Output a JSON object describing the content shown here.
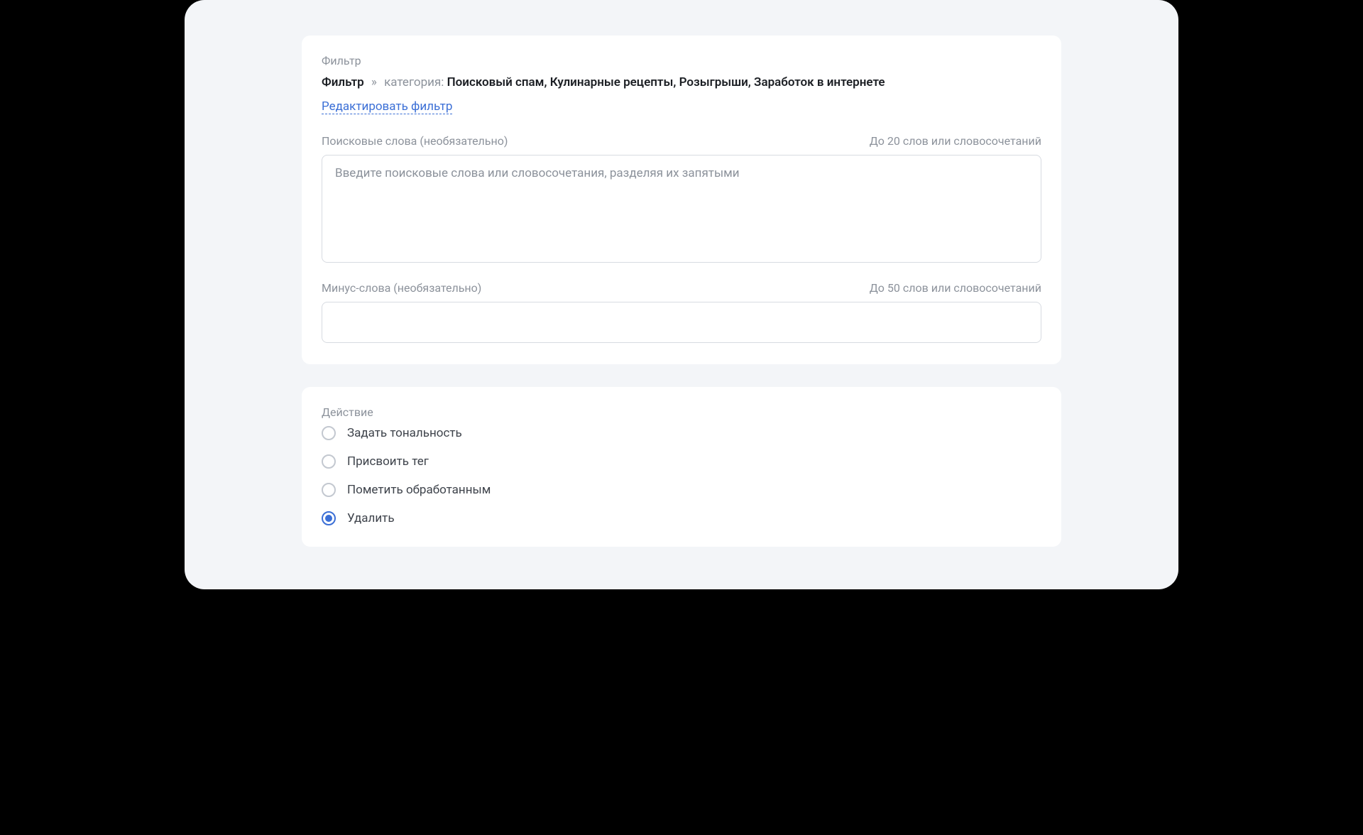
{
  "filter_card": {
    "section_label": "Фильтр",
    "breadcrumb": {
      "filter_word": "Фильтр",
      "separator": "»",
      "category_label": "категория:",
      "category_values": "Поисковый спам, Кулинарные рецепты, Розыгрыши, Заработок в интернете"
    },
    "edit_link": "Редактировать фильтр",
    "search_words": {
      "label": "Поисковые слова (необязательно)",
      "limit": "До 20 слов или словосочетаний",
      "placeholder": "Введите поисковые слова или словосочетания, разделяя их запятыми",
      "value": ""
    },
    "negative_words": {
      "label": "Минус-слова (необязательно)",
      "limit": "До 50 слов или словосочетаний",
      "placeholder": "",
      "value": ""
    }
  },
  "action_card": {
    "section_label": "Действие",
    "options": [
      {
        "label": "Задать тональность",
        "checked": false
      },
      {
        "label": "Присвоить тег",
        "checked": false
      },
      {
        "label": "Пометить обработанным",
        "checked": false
      },
      {
        "label": "Удалить",
        "checked": true
      }
    ]
  }
}
